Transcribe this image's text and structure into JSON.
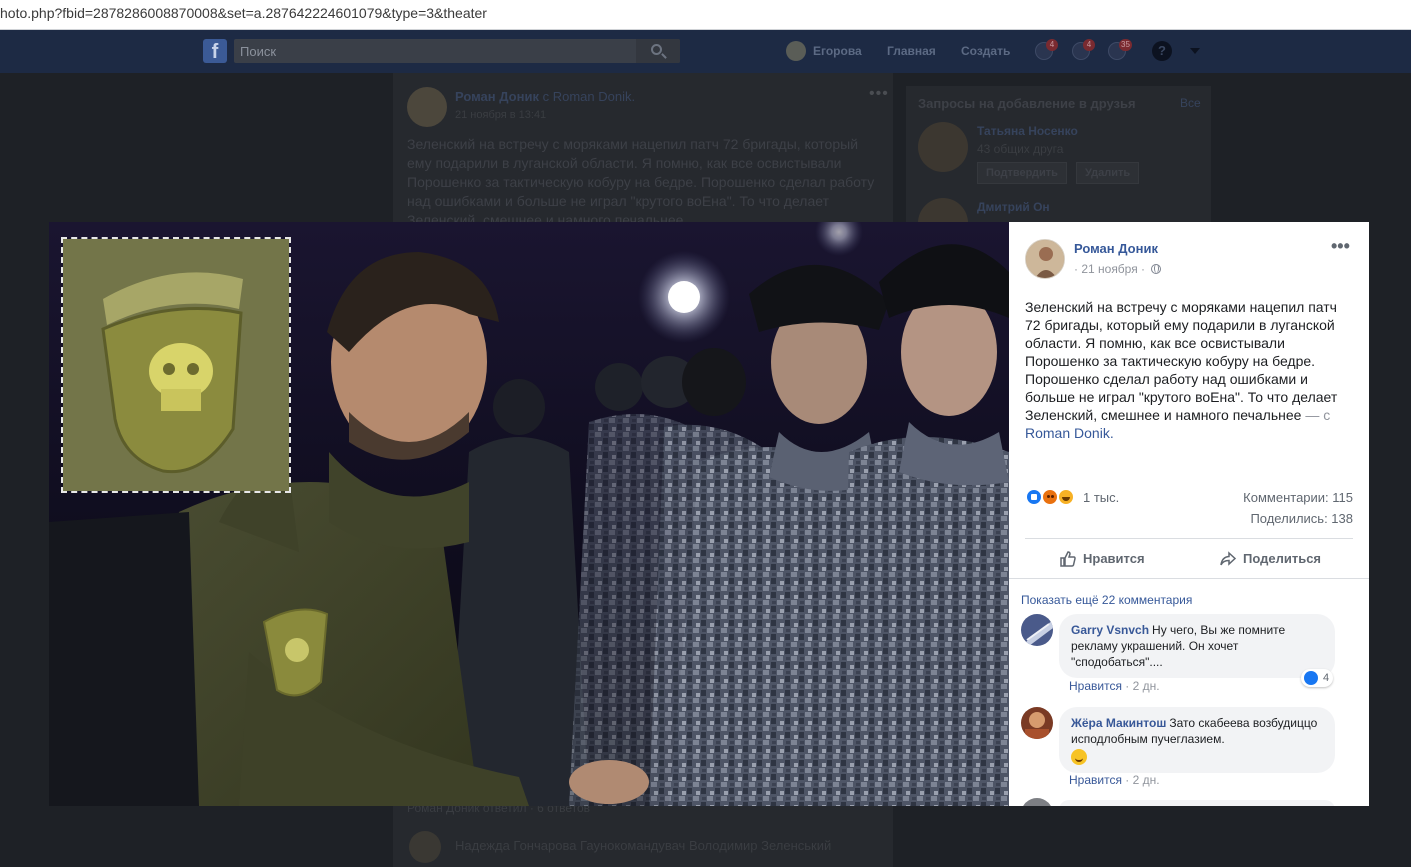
{
  "browser": {
    "url": "hoto.php?fbid=2878286008870008&set=a.287642224601079&type=3&theater"
  },
  "topbar": {
    "logo": "f",
    "search_placeholder": "Поиск",
    "profile_name": "Егорова",
    "home_label": "Главная",
    "create_label": "Создать",
    "friend_requests_badge": "4",
    "messages_badge": "4",
    "notifications_badge": "35",
    "help_label": "?"
  },
  "background_post": {
    "author": "Роман Доник",
    "with_text": "с Roman Donik.",
    "time": "21 ноября в 13:41",
    "text": "Зеленский на встречу с моряками нацепил патч 72 бригады, который ему подарили в луганской области. Я помню, как все освистывали Порошенко за тактическую кобуру на бедре. Порошенко сделал работу над ошибками и больше не играл \"крутого воЕна\". То что делает Зеленский, смешнее и намного печальнее",
    "bottom_text": "Роман Доник ответил · 6 ответов",
    "comment": "Надежда Гончарова Гаунокомандувач Володимир Зеленський"
  },
  "sidebar": {
    "title": "Запросы на добавление в друзья",
    "see_all": "Все",
    "friend1_name": "Татьяна Носенко",
    "friend1_mutual": "43 общих друга",
    "confirm_label": "Подтвердить",
    "delete_label": "Удалить",
    "friend2_name": "Дмитрий Он"
  },
  "panel": {
    "author": "Роман Доник",
    "time": "· 21 ноября ·",
    "text": "Зеленский на встречу с моряками нацепил патч 72 бригады, который ему подарили в луганской области. Я помню, как все освистывали Порошенко за тактическую кобуру на бедре. Порошенко сделал работу над ошибками и больше не играл \"крутого воЕна\". То что делает Зеленский, смешнее и намного печальнее",
    "with_text": " — с",
    "with_link": "Roman Donik.",
    "reaction_count": "1 тыс.",
    "comments_count": "Комментарии: 115",
    "shares_count": "Поделились: 138",
    "like_label": "Нравится",
    "share_label": "Поделиться",
    "more_comments": "Показать ещё 22 комментария",
    "reaction_icons": [
      "like-icon",
      "angry-icon",
      "haha-icon"
    ],
    "comments": [
      {
        "name": "Garry Vsnvch",
        "text": "Ну чего, Вы же помните рекламу украшений. Он хочет \"сподобаться\"....",
        "like_label": "Нравится",
        "time": "· 2 дн.",
        "reactions": "4"
      },
      {
        "name": "Жёра Макинтош",
        "text": "Зато скабеева возбудиццо исподлобным пучеглазием.",
        "like_label": "Нравится",
        "time": "· 2 дн.",
        "emoji": "smile-emoji-icon"
      }
    ]
  },
  "colors": {
    "fb_blue": "#365899",
    "link_blue": "#385898",
    "like_blue": "#1877f2",
    "text_gray": "#606770",
    "bubble_bg": "#f2f3f5"
  }
}
